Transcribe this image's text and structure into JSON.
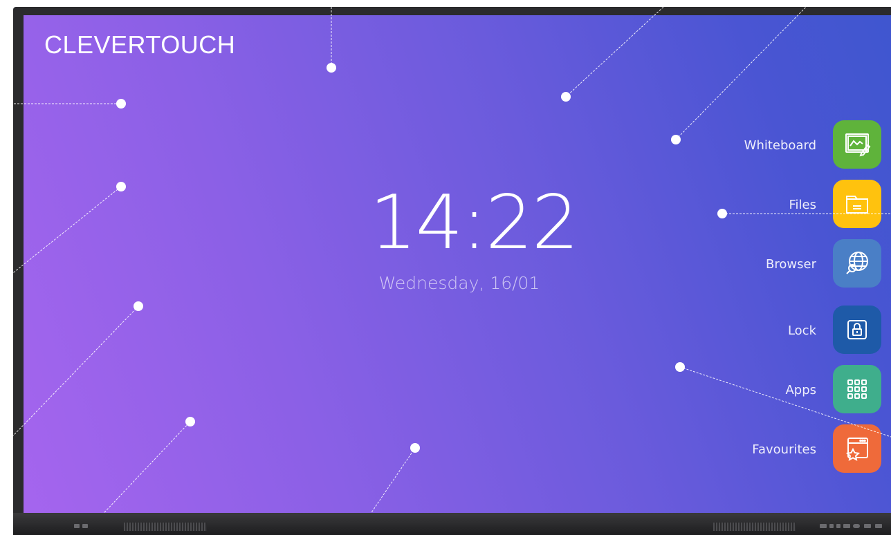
{
  "brand": {
    "name": "CLEVERTOUCH"
  },
  "clock": {
    "time": "14:22",
    "date": "Wednesday,  16/01"
  },
  "launcher": {
    "items": [
      {
        "label": "Whiteboard",
        "icon": "whiteboard-icon",
        "color": "#5fb33b"
      },
      {
        "label": "Files",
        "icon": "folder-icon",
        "color": "#ffc20e"
      },
      {
        "label": "Browser",
        "icon": "globe-search-icon",
        "color": "#4a7fc6"
      },
      {
        "label": "Lock",
        "icon": "lock-icon",
        "color": "#1e5aa8"
      },
      {
        "label": "Apps",
        "icon": "apps-grid-icon",
        "color": "#3fae8c"
      },
      {
        "label": "Favourites",
        "icon": "favourites-icon",
        "color": "#ef6a3a"
      }
    ]
  },
  "colors": {
    "gradient_start": "#a565ee",
    "gradient_end": "#3f56cf",
    "bezel": "#2b2b2d"
  }
}
